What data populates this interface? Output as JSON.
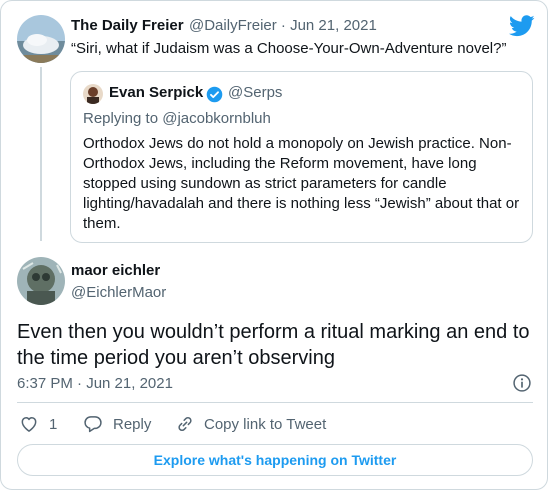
{
  "parent_tweet": {
    "author_name": "The Daily Freier",
    "author_handle_date": "@DailyFreier · Jun 21, 2021",
    "text": "“Siri, what if Judaism was a Choose-Your-Own-Adventure novel?”"
  },
  "quoted_tweet": {
    "author_name": "Evan Serpick",
    "author_handle": "@Serps",
    "replying_to": "Replying to @jacobkornbluh",
    "text": "Orthodox Jews do not hold a monopoly on Jewish practice. Non-Orthodox Jews, including the Reform movement, have long stopped using sundown as strict parameters for  candle lighting/havadalah and there is nothing less “Jewish” about that or them."
  },
  "main_tweet": {
    "author_name": "maor eichler",
    "author_handle": "@EichlerMaor",
    "text": "Even then you wouldn’t perform a ritual marking an end to the time period you aren’t observing",
    "timestamp": "6:37 PM · Jun 21, 2021"
  },
  "actions": {
    "like_count": "1",
    "reply_label": "Reply",
    "copy_link_label": "Copy link to Tweet"
  },
  "explore_label": "Explore what's happening on Twitter",
  "colors": {
    "accent": "#1d9bf0",
    "secondary_text": "#536471",
    "border": "#cfd9de"
  },
  "icons": [
    "twitter-bird-icon",
    "verified-badge-icon",
    "info-icon",
    "heart-icon",
    "reply-bubble-icon",
    "link-icon"
  ]
}
